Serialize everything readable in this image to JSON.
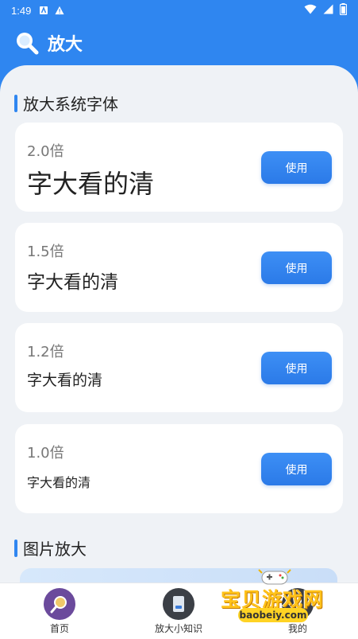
{
  "status": {
    "time": "1:49"
  },
  "app": {
    "title": "放大"
  },
  "sections": {
    "system_font": "放大系统字体",
    "image_zoom": "图片放大"
  },
  "cards": [
    {
      "multiplier": "2.0倍",
      "sample": "字大看的清",
      "button": "使用"
    },
    {
      "multiplier": "1.5倍",
      "sample": "字大看的清",
      "button": "使用"
    },
    {
      "multiplier": "1.2倍",
      "sample": "字大看的清",
      "button": "使用"
    },
    {
      "multiplier": "1.0倍",
      "sample": "字大看的清",
      "button": "使用"
    }
  ],
  "nav": [
    {
      "label": "首页",
      "icon": "magnifier-icon"
    },
    {
      "label": "放大小知识",
      "icon": "book-icon"
    },
    {
      "label": "我的",
      "icon": "user-icon"
    }
  ],
  "watermark": {
    "title": "宝贝游戏网",
    "url": "baobeiy.com"
  },
  "colors": {
    "primary": "#2f86f0",
    "background": "#eff2f6",
    "card": "#ffffff"
  }
}
